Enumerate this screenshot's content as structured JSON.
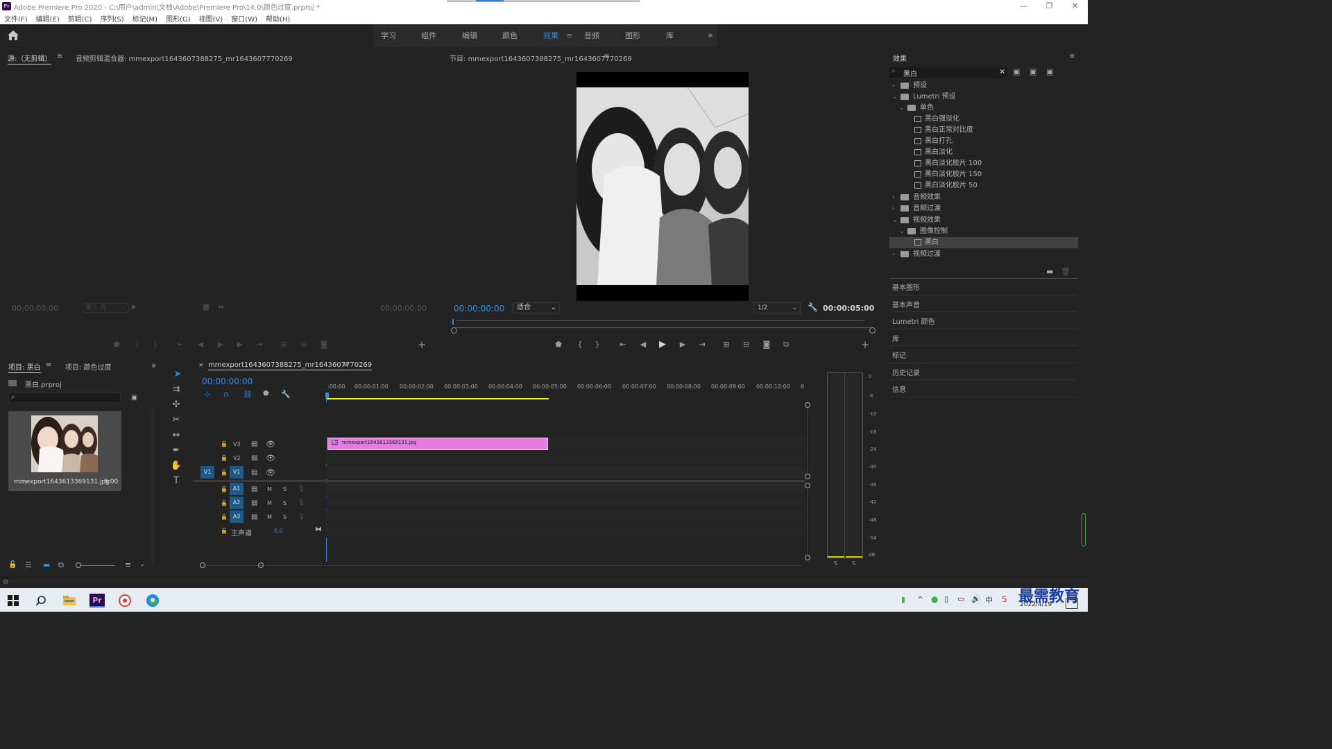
{
  "window": {
    "title": "Adobe Premiere Pro 2020 - C:\\用户\\admin\\文档\\Adobe\\Premiere Pro\\14.0\\颜色过度.prproj *",
    "logo": "Pr",
    "controls": [
      "—",
      "❐",
      "✕"
    ]
  },
  "menu": [
    "文件(F)",
    "编辑(E)",
    "剪辑(C)",
    "序列(S)",
    "标记(M)",
    "图形(G)",
    "视图(V)",
    "窗口(W)",
    "帮助(H)"
  ],
  "workspaces": {
    "tabs": [
      "学习",
      "组件",
      "编辑",
      "颜色",
      "效果",
      "音频",
      "图形",
      "库"
    ],
    "active": "效果",
    "more": "»",
    "menu_icon": "≡"
  },
  "source": {
    "tab_source": "源:（无剪辑）",
    "tab_mixer": "音频剪辑混合器: mmexport1643607388275_mr1643607770269",
    "timecode_left": "00;00;00;00",
    "timecode_right": "00;00;00;00",
    "page": "第 1 页"
  },
  "program": {
    "title": "节目: mmexport1643607388275_mr1643607770269",
    "timecode": "00:00:00:00",
    "fit": "适合",
    "resolution": "1/2",
    "duration": "00:00:05:00"
  },
  "project": {
    "tab_active": "项目: 黑白",
    "tab_other": "项目: 颜色过度",
    "file": "黑白.prproj",
    "clip_name": "mmexport1643613369131.jpg",
    "clip_duration": "5:00"
  },
  "timeline": {
    "tab": "mmexport1643607388275_mr1643607770269",
    "timecode": "00:00:00:00",
    "ruler": [
      ":00:00",
      "00:00:01:00",
      "00:00:02:00",
      "00:00:03:00",
      "00:00:04:00",
      "00:00:05:00",
      "00:00:06:00",
      "00:00:07:00",
      "00:00:08:00",
      "00:00:09:00",
      "00:00:10:00",
      "0"
    ],
    "video_tracks": [
      "V3",
      "V2",
      "V1"
    ],
    "audio_tracks": [
      "A1",
      "A2",
      "A3"
    ],
    "source_patch": "V1",
    "master_label": "主声道",
    "master_value": "0.0",
    "clip_label": "mmexport1643613369131.jpg",
    "clip_badge": "fx",
    "mute": "M",
    "solo": "S"
  },
  "effects": {
    "title": "效果",
    "search_value": "黑白",
    "tree": {
      "presets": "预设",
      "lumetri_presets": "Lumetri 预设",
      "mono": "单色",
      "mono_items": [
        "黑白强淡化",
        "黑白正常对比度",
        "黑白打孔",
        "黑白淡化",
        "黑白淡化胶片 100",
        "黑白淡化胶片 150",
        "黑白淡化胶片 50"
      ],
      "audio_effects": "音频效果",
      "audio_transitions": "音频过渡",
      "video_effects": "视频效果",
      "image_control": "图像控制",
      "selected": "黑白",
      "video_transitions": "视频过渡"
    }
  },
  "side_panels": [
    "基本图形",
    "基本声音",
    "Lumetri 颜色",
    "库",
    "标记",
    "历史记录",
    "信息"
  ],
  "audio_meter": {
    "scale": [
      "0",
      "-6",
      "-12",
      "-18",
      "-24",
      "-30",
      "-36",
      "-42",
      "-48",
      "-54",
      "dB"
    ],
    "solo": [
      "S",
      "S"
    ]
  },
  "taskbar": {
    "apps": [
      "windows-start",
      "search",
      "file-explorer",
      "premiere",
      "photo-app",
      "edge"
    ],
    "date": "2022/4/19",
    "watermark": "最需教育",
    "notification_count": "3"
  },
  "colors": {
    "accent": "#2d8ceb",
    "clip": "#e17ee0",
    "track_button": "#1d5a8a",
    "workarea": "#ffea00"
  }
}
